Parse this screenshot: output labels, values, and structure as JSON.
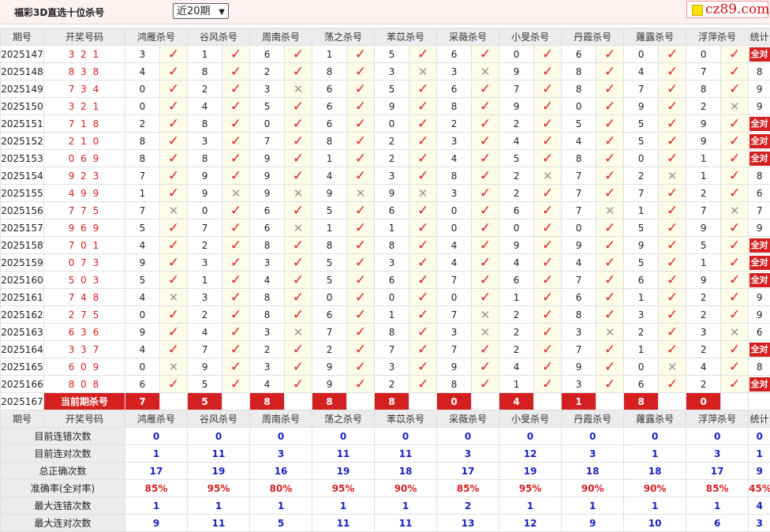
{
  "header": {
    "title": "福彩3D直选十位杀号",
    "range_select": "近20期",
    "logo_text": "cz89.com"
  },
  "columns": {
    "issue": "期号",
    "code": "开奖号码",
    "experts": [
      "鸿雁杀号",
      "谷风杀号",
      "周南杀号",
      "荡之杀号",
      "苯苡杀号",
      "采薇杀号",
      "小旻杀号",
      "丹霞杀号",
      "蕹露杀号",
      "浮萍杀号"
    ],
    "stat": "统计"
  },
  "rows": [
    {
      "issue": "2025147",
      "code": "3 2 1",
      "d": [
        3,
        1,
        6,
        1,
        5,
        6,
        0,
        6,
        0,
        0
      ],
      "r": [
        1,
        1,
        1,
        1,
        1,
        1,
        1,
        1,
        1,
        1
      ],
      "stat": "全对"
    },
    {
      "issue": "2025148",
      "code": "8 3 8",
      "d": [
        4,
        8,
        2,
        8,
        3,
        3,
        9,
        8,
        4,
        7
      ],
      "r": [
        1,
        1,
        1,
        1,
        0,
        0,
        1,
        1,
        1,
        1
      ],
      "stat": "8"
    },
    {
      "issue": "2025149",
      "code": "7 3 4",
      "d": [
        0,
        2,
        3,
        6,
        5,
        6,
        7,
        8,
        7,
        8
      ],
      "r": [
        1,
        1,
        0,
        1,
        1,
        1,
        1,
        1,
        1,
        1
      ],
      "stat": "9"
    },
    {
      "issue": "2025150",
      "code": "3 2 1",
      "d": [
        0,
        4,
        5,
        6,
        9,
        8,
        9,
        0,
        9,
        2
      ],
      "r": [
        1,
        1,
        1,
        1,
        1,
        1,
        1,
        1,
        1,
        0
      ],
      "stat": "9"
    },
    {
      "issue": "2025151",
      "code": "7 1 8",
      "d": [
        2,
        8,
        0,
        6,
        0,
        2,
        2,
        5,
        5,
        9
      ],
      "r": [
        1,
        1,
        1,
        1,
        1,
        1,
        1,
        1,
        1,
        1
      ],
      "stat": "全对"
    },
    {
      "issue": "2025152",
      "code": "2 1 0",
      "d": [
        8,
        3,
        7,
        8,
        2,
        3,
        4,
        4,
        5,
        9
      ],
      "r": [
        1,
        1,
        1,
        1,
        1,
        1,
        1,
        1,
        1,
        1
      ],
      "stat": "全对"
    },
    {
      "issue": "2025153",
      "code": "0 6 9",
      "d": [
        8,
        8,
        9,
        1,
        2,
        4,
        5,
        8,
        0,
        1
      ],
      "r": [
        1,
        1,
        1,
        1,
        1,
        1,
        1,
        1,
        1,
        1
      ],
      "stat": "全对"
    },
    {
      "issue": "2025154",
      "code": "9 2 3",
      "d": [
        7,
        9,
        9,
        4,
        3,
        8,
        2,
        7,
        2,
        1
      ],
      "r": [
        1,
        1,
        1,
        1,
        1,
        1,
        0,
        1,
        0,
        1
      ],
      "stat": "8"
    },
    {
      "issue": "2025155",
      "code": "4 9 9",
      "d": [
        1,
        9,
        9,
        9,
        9,
        3,
        2,
        7,
        7,
        2
      ],
      "r": [
        1,
        0,
        0,
        0,
        0,
        1,
        1,
        1,
        1,
        1
      ],
      "stat": "6"
    },
    {
      "issue": "2025156",
      "code": "7 7 5",
      "d": [
        7,
        0,
        6,
        5,
        6,
        0,
        6,
        7,
        1,
        7
      ],
      "r": [
        0,
        1,
        1,
        1,
        1,
        1,
        1,
        0,
        1,
        0
      ],
      "stat": "7"
    },
    {
      "issue": "2025157",
      "code": "9 6 9",
      "d": [
        5,
        7,
        6,
        1,
        1,
        0,
        0,
        0,
        5,
        9
      ],
      "r": [
        1,
        1,
        0,
        1,
        1,
        1,
        1,
        1,
        1,
        1
      ],
      "stat": "9"
    },
    {
      "issue": "2025158",
      "code": "7 0 1",
      "d": [
        4,
        2,
        8,
        8,
        8,
        4,
        9,
        9,
        9,
        5
      ],
      "r": [
        1,
        1,
        1,
        1,
        1,
        1,
        1,
        1,
        1,
        1
      ],
      "stat": "全对"
    },
    {
      "issue": "2025159",
      "code": "0 7 3",
      "d": [
        9,
        3,
        3,
        5,
        3,
        4,
        4,
        4,
        5,
        1
      ],
      "r": [
        1,
        1,
        1,
        1,
        1,
        1,
        1,
        1,
        1,
        1
      ],
      "stat": "全对"
    },
    {
      "issue": "2025160",
      "code": "5 0 3",
      "d": [
        5,
        1,
        4,
        5,
        6,
        7,
        6,
        7,
        6,
        9
      ],
      "r": [
        1,
        1,
        1,
        1,
        1,
        1,
        1,
        1,
        1,
        1
      ],
      "stat": "全对"
    },
    {
      "issue": "2025161",
      "code": "7 4 8",
      "d": [
        4,
        3,
        8,
        0,
        0,
        0,
        1,
        6,
        1,
        2
      ],
      "r": [
        0,
        1,
        1,
        1,
        1,
        1,
        1,
        1,
        1,
        1
      ],
      "stat": "9"
    },
    {
      "issue": "2025162",
      "code": "2 7 5",
      "d": [
        0,
        2,
        8,
        6,
        1,
        7,
        2,
        8,
        3,
        2
      ],
      "r": [
        1,
        1,
        1,
        1,
        1,
        0,
        1,
        1,
        1,
        1
      ],
      "stat": "9"
    },
    {
      "issue": "2025163",
      "code": "6 3 6",
      "d": [
        9,
        4,
        3,
        7,
        8,
        3,
        2,
        3,
        2,
        3
      ],
      "r": [
        1,
        1,
        0,
        1,
        1,
        0,
        1,
        0,
        1,
        0
      ],
      "stat": "6"
    },
    {
      "issue": "2025164",
      "code": "3 3 7",
      "d": [
        4,
        7,
        2,
        2,
        7,
        7,
        2,
        7,
        1,
        2
      ],
      "r": [
        1,
        1,
        1,
        1,
        1,
        1,
        1,
        1,
        1,
        1
      ],
      "stat": "全对"
    },
    {
      "issue": "2025165",
      "code": "6 0 9",
      "d": [
        0,
        9,
        3,
        9,
        3,
        9,
        4,
        9,
        0,
        4
      ],
      "r": [
        0,
        1,
        1,
        1,
        1,
        1,
        1,
        1,
        0,
        1
      ],
      "stat": "8"
    },
    {
      "issue": "2025166",
      "code": "8 0 8",
      "d": [
        6,
        5,
        4,
        9,
        2,
        8,
        1,
        3,
        6,
        2
      ],
      "r": [
        1,
        1,
        1,
        1,
        1,
        1,
        1,
        1,
        1,
        1
      ],
      "stat": "全对"
    }
  ],
  "current": {
    "issue": "2025167",
    "label": "当前期杀号",
    "d": [
      7,
      5,
      8,
      8,
      8,
      0,
      4,
      1,
      8,
      0
    ]
  },
  "summary": [
    {
      "label": "目前连错次数",
      "vals": [
        "0",
        "0",
        "0",
        "0",
        "0",
        "0",
        "0",
        "0",
        "0",
        "0",
        "0"
      ],
      "pct": false
    },
    {
      "label": "目前连对次数",
      "vals": [
        "1",
        "11",
        "3",
        "11",
        "11",
        "3",
        "12",
        "3",
        "1",
        "3",
        "1"
      ],
      "pct": false
    },
    {
      "label": "总正确次数",
      "vals": [
        "17",
        "19",
        "16",
        "19",
        "18",
        "17",
        "19",
        "18",
        "18",
        "17",
        "9"
      ],
      "pct": false
    },
    {
      "label": "准确率(全对率)",
      "vals": [
        "85%",
        "95%",
        "80%",
        "95%",
        "90%",
        "85%",
        "95%",
        "90%",
        "90%",
        "85%",
        "45%"
      ],
      "pct": true
    },
    {
      "label": "最大连错次数",
      "vals": [
        "1",
        "1",
        "1",
        "1",
        "1",
        "2",
        "1",
        "1",
        "1",
        "1",
        "4"
      ],
      "pct": false
    },
    {
      "label": "最大连对次数",
      "vals": [
        "9",
        "11",
        "5",
        "11",
        "11",
        "13",
        "12",
        "9",
        "10",
        "6",
        "3"
      ],
      "pct": false
    }
  ],
  "marks": {
    "right": "✓",
    "wrong": "✕"
  },
  "colors": {
    "accent": "#d42020",
    "blue": "#1a22c0",
    "header_bg": "#ececec",
    "mark_bg": "#fcfce8"
  }
}
